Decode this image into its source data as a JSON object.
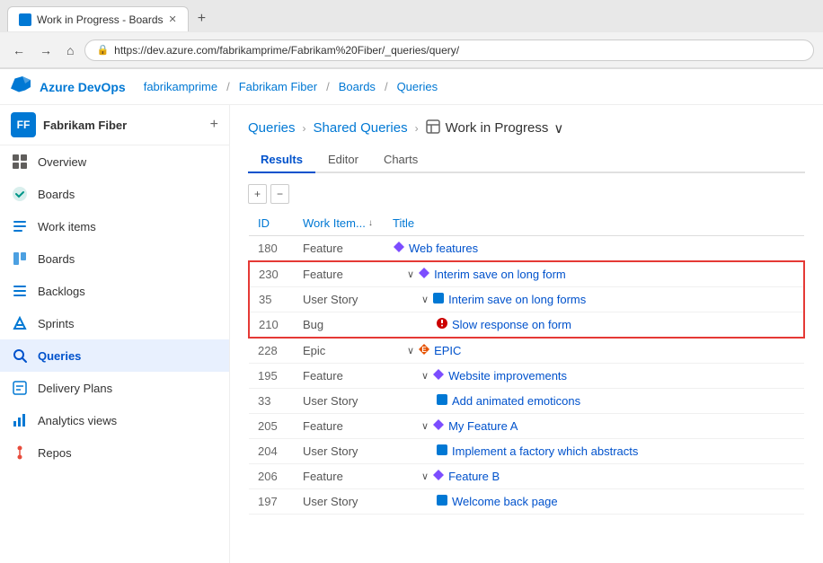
{
  "browser": {
    "tab_label": "Work in Progress - Boards",
    "url": "https://dev.azure.com/fabrikamprime/Fabrikam%20Fiber/_queries/query/",
    "nav_back": "←",
    "nav_forward": "→",
    "nav_home": "⌂"
  },
  "topbar": {
    "logo": "☁",
    "brand": "Azure DevOps",
    "breadcrumbs": [
      "fabrikamprime",
      "Fabrikam Fiber",
      "Boards",
      "Queries"
    ]
  },
  "sidebar": {
    "project_initials": "FF",
    "project_name": "Fabrikam Fiber",
    "items": [
      {
        "id": "overview",
        "label": "Overview",
        "icon": "📋"
      },
      {
        "id": "boards-main",
        "label": "Boards",
        "icon": "✅"
      },
      {
        "id": "work-items",
        "label": "Work items",
        "icon": "📄"
      },
      {
        "id": "boards",
        "label": "Boards",
        "icon": "⊞"
      },
      {
        "id": "backlogs",
        "label": "Backlogs",
        "icon": "≡"
      },
      {
        "id": "sprints",
        "label": "Sprints",
        "icon": "⚡"
      },
      {
        "id": "queries",
        "label": "Queries",
        "icon": "🔍"
      },
      {
        "id": "delivery-plans",
        "label": "Delivery Plans",
        "icon": "📅"
      },
      {
        "id": "analytics-views",
        "label": "Analytics views",
        "icon": "📊"
      },
      {
        "id": "repos",
        "label": "Repos",
        "icon": "🔧"
      }
    ]
  },
  "main": {
    "breadcrumb": {
      "queries": "Queries",
      "shared_queries": "Shared Queries",
      "current": "Work in Progress"
    },
    "tabs": [
      {
        "id": "results",
        "label": "Results"
      },
      {
        "id": "editor",
        "label": "Editor"
      },
      {
        "id": "charts",
        "label": "Charts"
      }
    ],
    "active_tab": "results",
    "table": {
      "columns": [
        "ID",
        "Work Item...",
        "Title"
      ],
      "rows": [
        {
          "id": "180",
          "type": "Feature",
          "indent": 0,
          "icon": "feature",
          "title": "Web features",
          "collapse": false,
          "highlight": "none"
        },
        {
          "id": "230",
          "type": "Feature",
          "indent": 1,
          "icon": "feature",
          "title": "Interim save on long form",
          "collapse": true,
          "highlight": "top"
        },
        {
          "id": "35",
          "type": "User Story",
          "indent": 2,
          "icon": "story",
          "title": "Interim save on long forms",
          "collapse": true,
          "highlight": "mid"
        },
        {
          "id": "210",
          "type": "Bug",
          "indent": 3,
          "icon": "bug",
          "title": "Slow response on form",
          "collapse": false,
          "highlight": "bot"
        },
        {
          "id": "228",
          "type": "Epic",
          "indent": 1,
          "icon": "epic",
          "title": "EPIC",
          "collapse": true,
          "highlight": "none"
        },
        {
          "id": "195",
          "type": "Feature",
          "indent": 2,
          "icon": "feature",
          "title": "Website improvements",
          "collapse": true,
          "highlight": "none"
        },
        {
          "id": "33",
          "type": "User Story",
          "indent": 3,
          "icon": "story",
          "title": "Add animated emoticons",
          "collapse": false,
          "highlight": "none"
        },
        {
          "id": "205",
          "type": "Feature",
          "indent": 2,
          "icon": "feature",
          "title": "My Feature A",
          "collapse": true,
          "highlight": "none"
        },
        {
          "id": "204",
          "type": "User Story",
          "indent": 3,
          "icon": "story",
          "title": "Implement a factory which abstracts",
          "collapse": false,
          "highlight": "none"
        },
        {
          "id": "206",
          "type": "Feature",
          "indent": 2,
          "icon": "feature",
          "title": "Feature B",
          "collapse": true,
          "highlight": "none"
        },
        {
          "id": "197",
          "type": "User Story",
          "indent": 3,
          "icon": "story",
          "title": "Welcome back page",
          "collapse": false,
          "highlight": "none"
        }
      ]
    },
    "toolbar": {
      "add": "+",
      "remove": "−"
    }
  }
}
